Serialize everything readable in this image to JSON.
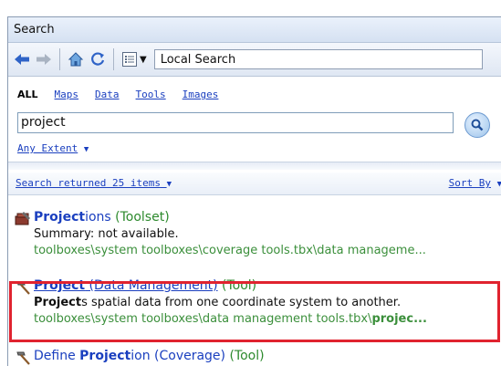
{
  "window": {
    "title": "Search"
  },
  "toolbar": {
    "scope_value": "Local Search"
  },
  "filters": {
    "items": [
      "ALL",
      "Maps",
      "Data",
      "Tools",
      "Images"
    ]
  },
  "search": {
    "value": "project"
  },
  "extent": {
    "label": "Any Extent"
  },
  "results_header": {
    "count_label": "Search returned 25 items",
    "sort_label": "Sort By"
  },
  "results": [
    {
      "title_hl": "Project",
      "title_rest": "ions",
      "type": "(Toolset)",
      "summary_hl": "",
      "summary": "Summary: not available.",
      "path": "toolboxes\\system toolboxes\\coverage tools.tbx\\data manageme..."
    },
    {
      "title_hl": "Project",
      "title_rest": " (Data Management)",
      "type": "(Tool)",
      "summary_hl": "Project",
      "summary": "s spatial data from one coordinate system to another.",
      "path": "toolboxes\\system toolboxes\\data management tools.tbx\\",
      "path_hl": "projec..."
    },
    {
      "title_pre": "Define ",
      "title_hl": "Project",
      "title_rest": "ion (Coverage)",
      "type": "(Tool)"
    }
  ],
  "colors": {
    "highlight_border": "#e0232f",
    "link": "#1a3fbf",
    "path_green": "#3b8f3b"
  }
}
